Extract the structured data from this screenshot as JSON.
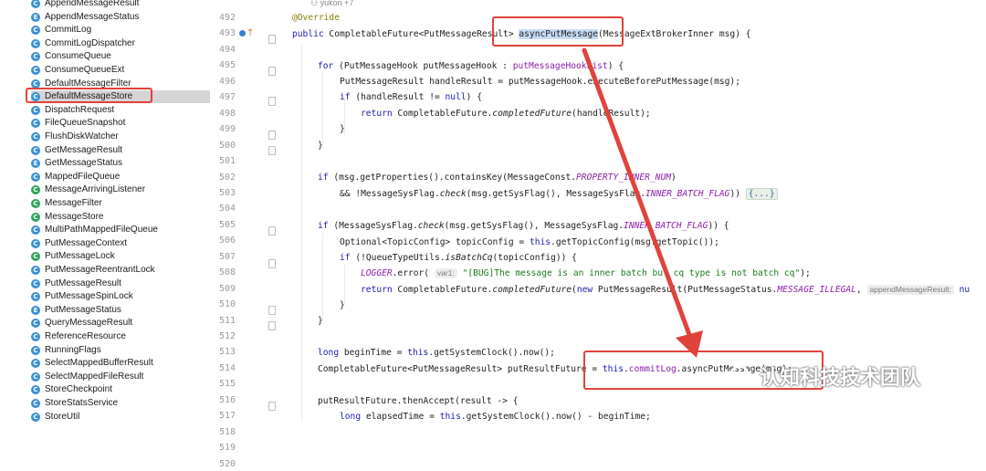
{
  "sidebar": {
    "items": [
      {
        "icon": "C",
        "label": "AppendMessageResult",
        "color": "#3a8fd6"
      },
      {
        "icon": "E",
        "label": "AppendMessageStatus",
        "color": "#3a8fd6"
      },
      {
        "icon": "C",
        "label": "CommitLog",
        "color": "#3a8fd6"
      },
      {
        "icon": "C",
        "label": "CommitLogDispatcher",
        "color": "#3a8fd6"
      },
      {
        "icon": "C",
        "label": "ConsumeQueue",
        "color": "#3a8fd6"
      },
      {
        "icon": "C",
        "label": "ConsumeQueueExt",
        "color": "#3a8fd6"
      },
      {
        "icon": "C",
        "label": "DefaultMessageFilter",
        "color": "#3a8fd6"
      },
      {
        "icon": "C",
        "label": "DefaultMessageStore",
        "color": "#3a8fd6"
      },
      {
        "icon": "C",
        "label": "DispatchRequest",
        "color": "#3a8fd6"
      },
      {
        "icon": "C",
        "label": "FileQueueSnapshot",
        "color": "#3a8fd6"
      },
      {
        "icon": "C",
        "label": "FlushDiskWatcher",
        "color": "#3a8fd6"
      },
      {
        "icon": "C",
        "label": "GetMessageResult",
        "color": "#3a8fd6"
      },
      {
        "icon": "E",
        "label": "GetMessageStatus",
        "color": "#3a8fd6"
      },
      {
        "icon": "C",
        "label": "MappedFileQueue",
        "color": "#3a8fd6"
      },
      {
        "icon": "C",
        "label": "MessageArrivingListener",
        "color": "#2fa35c"
      },
      {
        "icon": "C",
        "label": "MessageFilter",
        "color": "#2fa35c"
      },
      {
        "icon": "C",
        "label": "MessageStore",
        "color": "#2fa35c"
      },
      {
        "icon": "C",
        "label": "MultiPathMappedFileQueue",
        "color": "#3a8fd6"
      },
      {
        "icon": "C",
        "label": "PutMessageContext",
        "color": "#3a8fd6"
      },
      {
        "icon": "C",
        "label": "PutMessageLock",
        "color": "#2fa35c"
      },
      {
        "icon": "C",
        "label": "PutMessageReentrantLock",
        "color": "#3a8fd6"
      },
      {
        "icon": "C",
        "label": "PutMessageResult",
        "color": "#3a8fd6"
      },
      {
        "icon": "C",
        "label": "PutMessageSpinLock",
        "color": "#3a8fd6"
      },
      {
        "icon": "E",
        "label": "PutMessageStatus",
        "color": "#3a8fd6"
      },
      {
        "icon": "C",
        "label": "QueryMessageResult",
        "color": "#3a8fd6"
      },
      {
        "icon": "C",
        "label": "ReferenceResource",
        "color": "#3a8fd6"
      },
      {
        "icon": "C",
        "label": "RunningFlags",
        "color": "#3a8fd6"
      },
      {
        "icon": "C",
        "label": "SelectMappedBufferResult",
        "color": "#3a8fd6"
      },
      {
        "icon": "C",
        "label": "SelectMappedFileResult",
        "color": "#3a8fd6"
      },
      {
        "icon": "C",
        "label": "StoreCheckpoint",
        "color": "#3a8fd6"
      },
      {
        "icon": "C",
        "label": "StoreStatsService",
        "color": "#3a8fd6"
      },
      {
        "icon": "C",
        "label": "StoreUtil",
        "color": "#3a8fd6"
      }
    ],
    "selected_index": 7
  },
  "editor": {
    "author_hint": "yukon +7",
    "line_numbers": [
      "492",
      "493",
      "494",
      "495",
      "496",
      "497",
      "498",
      "499",
      "500",
      "501",
      "502",
      "503",
      "504",
      "505",
      "506",
      "507",
      "508",
      "509",
      "510",
      "511",
      "512",
      "513",
      "514",
      "515",
      "516",
      "517",
      "518",
      "519",
      "520"
    ],
    "hint_var1": "var1:",
    "hint_append": "appendMessageResult:",
    "hint_append_tail": "nu",
    "fold_placeholder": "{...}"
  },
  "watermark": {
    "text": "认知科技技术团队"
  },
  "colors": {
    "highlight_red": "#e0433a",
    "keyword": "#1b1bb5",
    "string": "#1e7a1e",
    "constant": "#8a1fa8",
    "annotation": "#8a7d00"
  }
}
